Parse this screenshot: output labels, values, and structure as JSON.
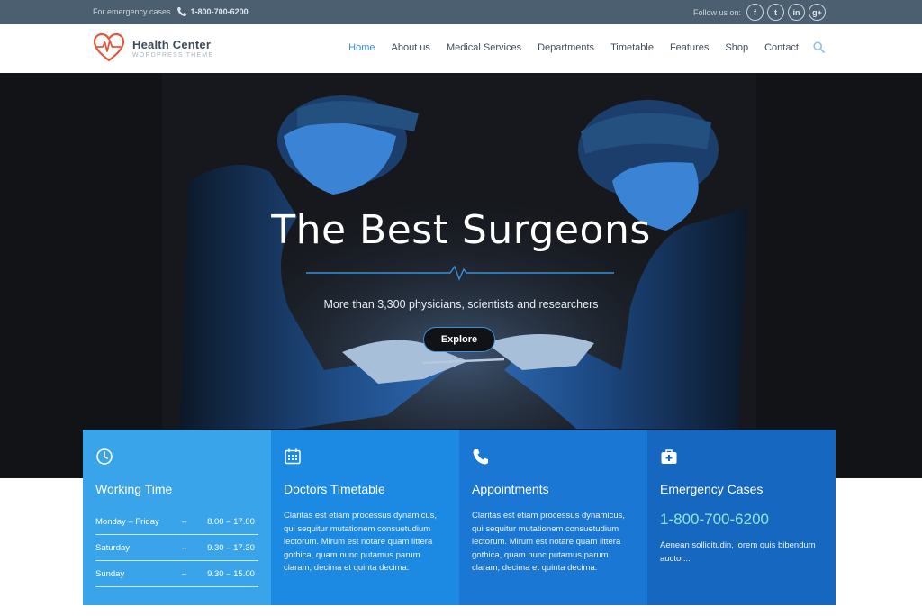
{
  "topbar": {
    "emergency_label": "For emergency cases",
    "emergency_phone": "1-800-700-6200",
    "follow_label": "Follow us on:",
    "social": [
      {
        "icon": "facebook-icon",
        "glyph": "f"
      },
      {
        "icon": "twitter-icon",
        "glyph": "t"
      },
      {
        "icon": "linkedin-icon",
        "glyph": "in"
      },
      {
        "icon": "googleplus-icon",
        "glyph": "g+"
      }
    ]
  },
  "brand": {
    "name": "Health Center",
    "tagline": "WORDPRESS THEME",
    "accent": "#3d8fd6",
    "logo_color": "#e2583e"
  },
  "nav": {
    "items": [
      {
        "label": "Home",
        "active": true
      },
      {
        "label": "About us"
      },
      {
        "label": "Medical Services"
      },
      {
        "label": "Departments"
      },
      {
        "label": "Timetable"
      },
      {
        "label": "Features"
      },
      {
        "label": "Shop"
      },
      {
        "label": "Contact"
      }
    ]
  },
  "hero": {
    "title": "The Best Surgeons",
    "subtitle": "More than 3,300 physicians, scientists and researchers",
    "button": "Explore"
  },
  "boxes": {
    "working": {
      "title": "Working Time",
      "rows": [
        {
          "day": "Monday – Friday",
          "sep": "–",
          "time": "8.00 – 17.00"
        },
        {
          "day": "Saturday",
          "sep": "–",
          "time": "9.30 – 17.30"
        },
        {
          "day": "Sunday",
          "sep": "–",
          "time": "9.30 – 15.00"
        }
      ]
    },
    "timetable": {
      "title": "Doctors Timetable",
      "text": "Claritas est etiam processus dynamicus, qui sequitur mutationem consuetudium lectorum. Mirum est notare quam littera gothica, quam nunc putamus parum claram, decima et quinta decima."
    },
    "appointments": {
      "title": "Appointments",
      "text": "Claritas est etiam processus dynamicus, qui sequitur mutationem consuetudium lectorum. Mirum est notare quam littera gothica, quam nunc putamus parum claram, decima et quinta decima."
    },
    "emergency": {
      "title": "Emergency Cases",
      "phone": "1-800-700-6200",
      "text": "Aenean sollicitudin, lorem quis bibendum auctor..."
    }
  }
}
